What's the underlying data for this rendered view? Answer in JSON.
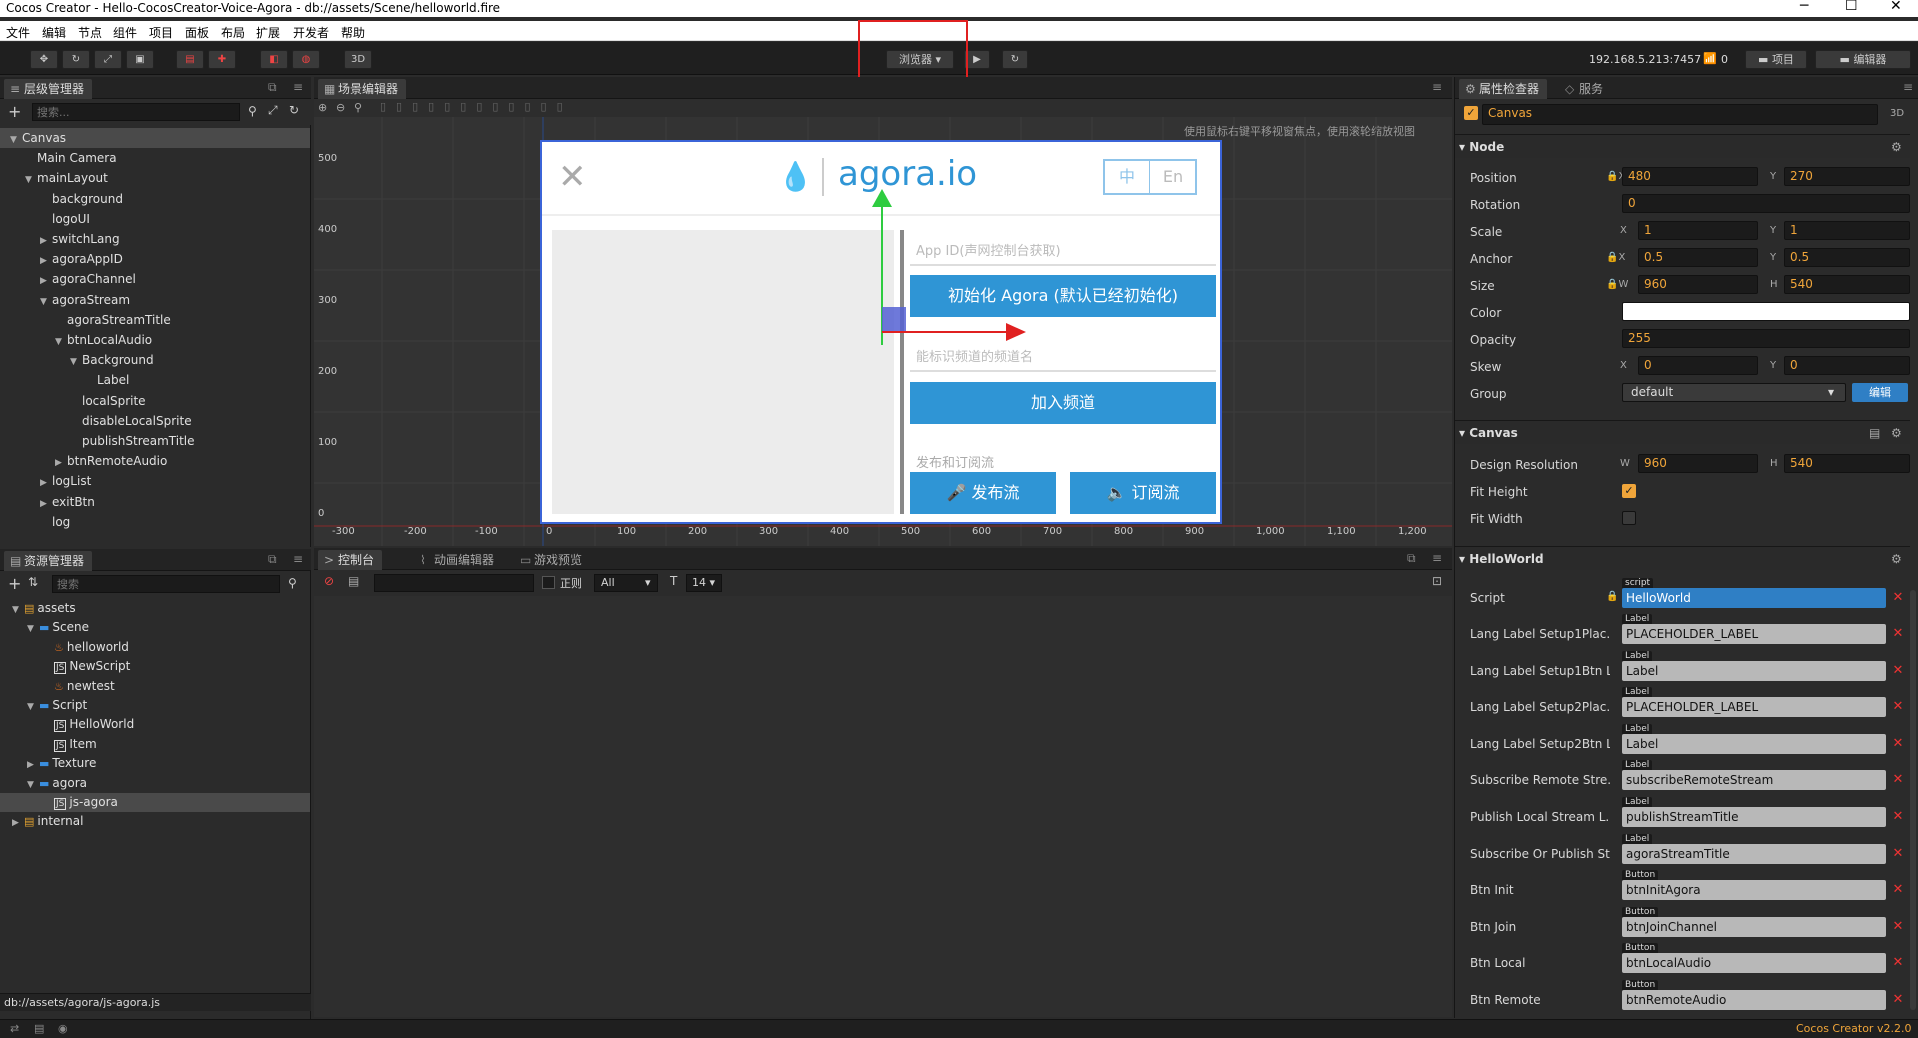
{
  "window": {
    "title": "Cocos Creator - Hello-CocosCreator-Voice-Agora - db://assets/Scene/helloworld.fire"
  },
  "menu": [
    "文件",
    "编辑",
    "节点",
    "组件",
    "项目",
    "面板",
    "布局",
    "扩展",
    "开发者",
    "帮助"
  ],
  "toolbar": {
    "preview_target": "浏览器",
    "three_d": "3D",
    "ip": "192.168.5.213:7457",
    "connections": "0",
    "project_btn": "项目",
    "editor_btn": "编辑器"
  },
  "hierarchy": {
    "title": "层级管理器",
    "search_placeholder": "搜索...",
    "nodes": [
      {
        "label": "Canvas",
        "depth": 0,
        "arrow": "▼"
      },
      {
        "label": "Main Camera",
        "depth": 1,
        "arrow": ""
      },
      {
        "label": "mainLayout",
        "depth": 1,
        "arrow": "▼"
      },
      {
        "label": "background",
        "depth": 2,
        "arrow": ""
      },
      {
        "label": "logoUI",
        "depth": 2,
        "arrow": ""
      },
      {
        "label": "switchLang",
        "depth": 2,
        "arrow": "▶"
      },
      {
        "label": "agoraAppID",
        "depth": 2,
        "arrow": "▶"
      },
      {
        "label": "agoraChannel",
        "depth": 2,
        "arrow": "▶"
      },
      {
        "label": "agoraStream",
        "depth": 2,
        "arrow": "▼"
      },
      {
        "label": "agoraStreamTitle",
        "depth": 3,
        "arrow": ""
      },
      {
        "label": "btnLocalAudio",
        "depth": 3,
        "arrow": "▼"
      },
      {
        "label": "Background",
        "depth": 4,
        "arrow": "▼"
      },
      {
        "label": "Label",
        "depth": 5,
        "arrow": ""
      },
      {
        "label": "localSprite",
        "depth": 4,
        "arrow": ""
      },
      {
        "label": "disableLocalSprite",
        "depth": 4,
        "arrow": ""
      },
      {
        "label": "publishStreamTitle",
        "depth": 4,
        "arrow": ""
      },
      {
        "label": "btnRemoteAudio",
        "depth": 3,
        "arrow": "▶"
      },
      {
        "label": "logList",
        "depth": 2,
        "arrow": "▶"
      },
      {
        "label": "exitBtn",
        "depth": 2,
        "arrow": "▶"
      },
      {
        "label": "log",
        "depth": 2,
        "arrow": ""
      }
    ]
  },
  "assets": {
    "title": "资源管理器",
    "search_placeholder": "搜索",
    "items": [
      {
        "label": "assets",
        "depth": 0,
        "arrow": "▼",
        "icon": "db"
      },
      {
        "label": "Scene",
        "depth": 1,
        "arrow": "▼",
        "icon": "folder"
      },
      {
        "label": "helloworld",
        "depth": 2,
        "arrow": "",
        "icon": "fire"
      },
      {
        "label": "NewScript",
        "depth": 2,
        "arrow": "",
        "icon": "js"
      },
      {
        "label": "newtest",
        "depth": 2,
        "arrow": "",
        "icon": "fire"
      },
      {
        "label": "Script",
        "depth": 1,
        "arrow": "▼",
        "icon": "folder"
      },
      {
        "label": "HelloWorld",
        "depth": 2,
        "arrow": "",
        "icon": "js"
      },
      {
        "label": "Item",
        "depth": 2,
        "arrow": "",
        "icon": "js"
      },
      {
        "label": "Texture",
        "depth": 1,
        "arrow": "▶",
        "icon": "folder"
      },
      {
        "label": "agora",
        "depth": 1,
        "arrow": "▼",
        "icon": "folder"
      },
      {
        "label": "js-agora",
        "depth": 2,
        "arrow": "",
        "icon": "js",
        "selected": true
      },
      {
        "label": "internal",
        "depth": 0,
        "arrow": "▶",
        "icon": "db"
      }
    ],
    "path": "db://assets/agora/js-agora.js"
  },
  "scene": {
    "title": "场景编辑器",
    "hint": "使用鼠标右键平移视窗焦点，使用滚轮缩放视图",
    "y_ticks": [
      "500",
      "400",
      "300",
      "200",
      "100",
      "0"
    ],
    "x_ticks": [
      "-300",
      "-200",
      "-100",
      "0",
      "100",
      "200",
      "300",
      "400",
      "500",
      "600",
      "700",
      "800",
      "900",
      "1,000",
      "1,100",
      "1,200"
    ],
    "game": {
      "logo": "agora.io",
      "lang_zh": "中",
      "lang_en": "En",
      "appid_placeholder": "App ID(声网控制台获取)",
      "init_btn": "初始化 Agora (默认已经初始化)",
      "channel_placeholder": "能标识频道的频道名",
      "join_btn": "加入频道",
      "pubsub_title": "发布和订阅流",
      "publish_btn": "发布流",
      "subscribe_btn": "订阅流"
    }
  },
  "console": {
    "tabs": [
      "控制台",
      "动画编辑器",
      "游戏预览"
    ],
    "regex": "正则",
    "level": "All",
    "font_size": "14"
  },
  "inspector": {
    "tabs": [
      "属性检查器",
      "服务"
    ],
    "node_name": "Canvas",
    "three_d": "3D",
    "node_section": "Node",
    "position": {
      "x": "480",
      "y": "270"
    },
    "rotation": "0",
    "scale": {
      "x": "1",
      "y": "1"
    },
    "anchor": {
      "x": "0.5",
      "y": "0.5"
    },
    "size": {
      "w": "960",
      "h": "540"
    },
    "opacity": "255",
    "skew": {
      "x": "0",
      "y": "0"
    },
    "group": "default",
    "edit_btn": "编辑",
    "labels": {
      "position": "Position",
      "rotation": "Rotation",
      "scale": "Scale",
      "anchor": "Anchor",
      "size": "Size",
      "color": "Color",
      "opacity": "Opacity",
      "skew": "Skew",
      "group": "Group",
      "design": "Design Resolution",
      "fit_height": "Fit Height",
      "fit_width": "Fit Width",
      "script": "Script"
    },
    "canvas_section": "Canvas",
    "design_res": {
      "w": "960",
      "h": "540"
    },
    "hw_section": "HelloWorld",
    "script_tag": "script",
    "script_value": "HelloWorld",
    "refs": [
      {
        "label": "Lang Label Setup1Plac...",
        "tag": "Label",
        "value": "PLACEHOLDER_LABEL"
      },
      {
        "label": "Lang Label Setup1Btn L...",
        "tag": "Label",
        "value": "Label"
      },
      {
        "label": "Lang Label Setup2Plac...",
        "tag": "Label",
        "value": "PLACEHOLDER_LABEL"
      },
      {
        "label": "Lang Label Setup2Btn L...",
        "tag": "Label",
        "value": "Label"
      },
      {
        "label": "Subscribe Remote Stre...",
        "tag": "Label",
        "value": "subscribeRemoteStream"
      },
      {
        "label": "Publish Local Stream L...",
        "tag": "Label",
        "value": "publishStreamTitle"
      },
      {
        "label": "Subscribe Or Publish St...",
        "tag": "Label",
        "value": "agoraStreamTitle"
      },
      {
        "label": "Btn Init",
        "tag": "Button",
        "value": "btnInitAgora"
      },
      {
        "label": "Btn Join",
        "tag": "Button",
        "value": "btnJoinChannel"
      },
      {
        "label": "Btn Local",
        "tag": "Button",
        "value": "btnLocalAudio"
      },
      {
        "label": "Btn Remote",
        "tag": "Button",
        "value": "btnRemoteAudio"
      }
    ]
  },
  "statusbar": {
    "version": "Cocos Creator v2.2.0"
  },
  "colors": {
    "accent": "#2f95d5",
    "highlight": "#e02020",
    "orange": "#f0a53a"
  }
}
